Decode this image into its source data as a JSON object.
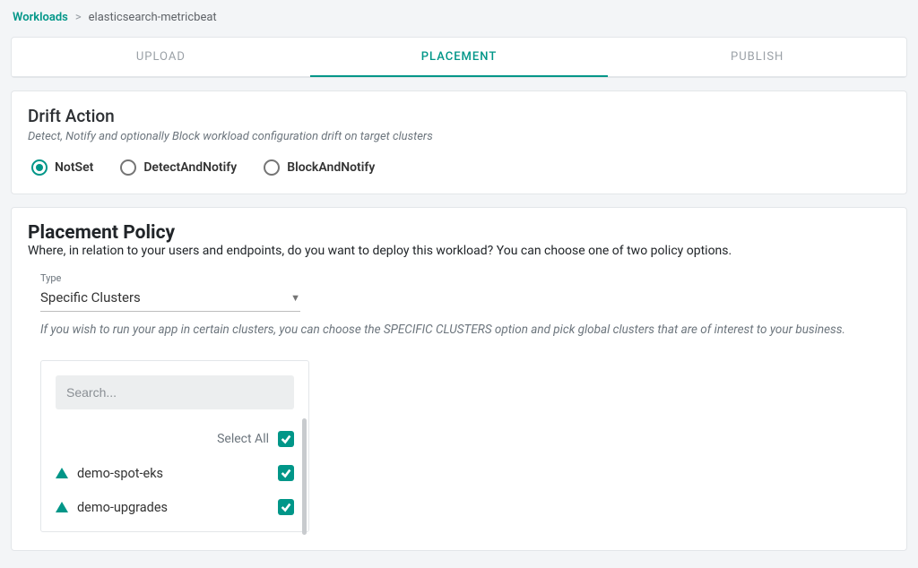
{
  "breadcrumb": {
    "root": "Workloads",
    "current": "elasticsearch-metricbeat"
  },
  "tabs": {
    "upload": "UPLOAD",
    "placement": "PLACEMENT",
    "publish": "PUBLISH"
  },
  "drift": {
    "title": "Drift Action",
    "subtitle": "Detect, Notify and optionally Block workload configuration drift on target clusters",
    "options": {
      "notset": "NotSet",
      "detect": "DetectAndNotify",
      "block": "BlockAndNotify"
    }
  },
  "placement": {
    "title": "Placement Policy",
    "subtitle": "Where, in relation to your users and endpoints, do you want to deploy this workload? You can choose one of two policy options.",
    "type_label": "Type",
    "type_value": "Specific Clusters",
    "helper": "If you wish to run your app in certain clusters, you can choose the SPECIFIC CLUSTERS option and pick global clusters that are of interest to your business."
  },
  "clusters": {
    "search_placeholder": "Search...",
    "select_all": "Select All",
    "items": [
      {
        "name": "demo-spot-eks",
        "checked": true
      },
      {
        "name": "demo-upgrades",
        "checked": true
      }
    ]
  }
}
